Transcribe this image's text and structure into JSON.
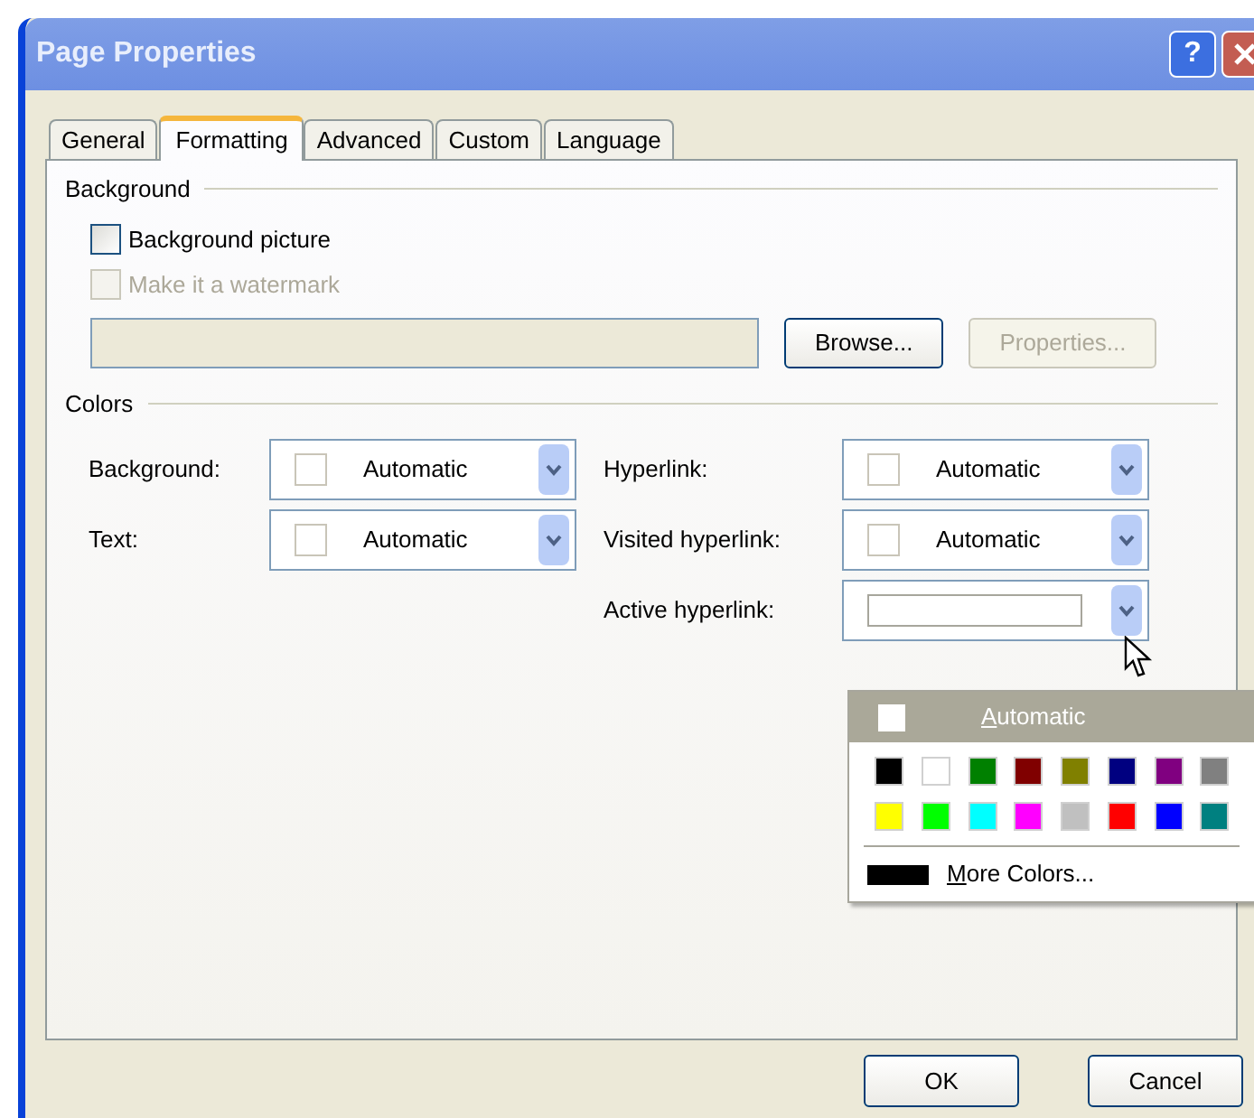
{
  "window": {
    "title": "Page Properties",
    "help": "?"
  },
  "tabs": [
    {
      "label": "General",
      "selected": false
    },
    {
      "label": "Formatting",
      "selected": true
    },
    {
      "label": "Advanced",
      "selected": false
    },
    {
      "label": "Custom",
      "selected": false
    },
    {
      "label": "Language",
      "selected": false
    }
  ],
  "background": {
    "heading": "Background",
    "checkboxes": [
      {
        "label": "Background picture",
        "checked": false,
        "disabled": false
      },
      {
        "label": "Make it a watermark",
        "checked": false,
        "disabled": true
      }
    ],
    "buttons": [
      {
        "label": "Browse...",
        "disabled": false
      },
      {
        "label": "Properties...",
        "disabled": true
      }
    ]
  },
  "colors": {
    "heading": "Colors",
    "left": [
      {
        "label": "Background:",
        "value": "Automatic"
      },
      {
        "label": "Text:",
        "value": "Automatic"
      }
    ],
    "right": [
      {
        "label": "Hyperlink:",
        "value": "Automatic"
      },
      {
        "label": "Visited hyperlink:",
        "value": "Automatic"
      },
      {
        "label": "Active hyperlink:",
        "open": true
      }
    ]
  },
  "color_menu": {
    "automatic": "Automatic",
    "more": "More Colors...",
    "swatches": [
      {
        "color": "#000000"
      },
      {
        "color": "#ffffff"
      },
      {
        "color": "#008000"
      },
      {
        "color": "#800000"
      },
      {
        "color": "#808000"
      },
      {
        "color": "#000080"
      },
      {
        "color": "#800080"
      },
      {
        "color": "#808080"
      },
      {
        "color": "#ffff00"
      },
      {
        "color": "#00ff00"
      },
      {
        "color": "#00ffff"
      },
      {
        "color": "#ff00ff"
      },
      {
        "color": "#c0c0c0"
      },
      {
        "color": "#ff0000"
      },
      {
        "color": "#0000ff"
      },
      {
        "color": "#008080"
      }
    ]
  },
  "buttons": [
    "OK",
    "Cancel"
  ]
}
